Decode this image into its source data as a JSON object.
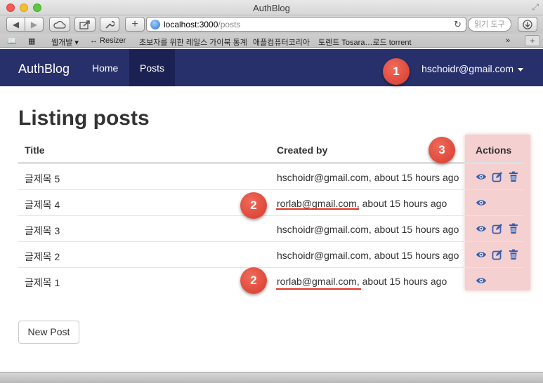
{
  "browser": {
    "window_title": "AuthBlog",
    "url_host": "localhost:3000",
    "url_path": "/posts",
    "search_placeholder": "읽기 도구",
    "bookmarks": [
      "웹개발 ▾",
      "↔ Resizer",
      "초보자를 위한 레일스 가이북 통계",
      "애플컴퓨터코리아",
      "토렌트 Tosara…로드 torrent"
    ]
  },
  "navbar": {
    "brand": "AuthBlog",
    "links": [
      "Home",
      "Posts"
    ],
    "active": "Posts",
    "user": "hschoidr@gmail.com"
  },
  "page": {
    "title": "Listing posts",
    "columns": [
      "Title",
      "Created by",
      "Actions"
    ],
    "rows": [
      {
        "title": "글제목 5",
        "author": "hschoidr@gmail.com",
        "time": ", about 15 hours ago",
        "actions": [
          "show",
          "edit",
          "destroy"
        ]
      },
      {
        "title": "글제목 4",
        "author": "rorlab@gmail.com",
        "time": ", about 15 hours ago",
        "actions": [
          "show"
        ]
      },
      {
        "title": "글제목 3",
        "author": "hschoidr@gmail.com",
        "time": ", about 15 hours ago",
        "actions": [
          "show",
          "edit",
          "destroy"
        ]
      },
      {
        "title": "글제목 2",
        "author": "hschoidr@gmail.com",
        "time": ", about 15 hours ago",
        "actions": [
          "show",
          "edit",
          "destroy"
        ]
      },
      {
        "title": "글제목 1",
        "author": "rorlab@gmail.com",
        "time": ", about 15 hours ago",
        "actions": [
          "show"
        ]
      }
    ],
    "new_button": "New Post"
  },
  "callouts": [
    "1",
    "2",
    "3",
    "2"
  ],
  "colors": {
    "navbar_bg": "#27306b",
    "icon": "#3b5fa8",
    "callout": "#d63a2c",
    "highlight": "#e99696"
  }
}
